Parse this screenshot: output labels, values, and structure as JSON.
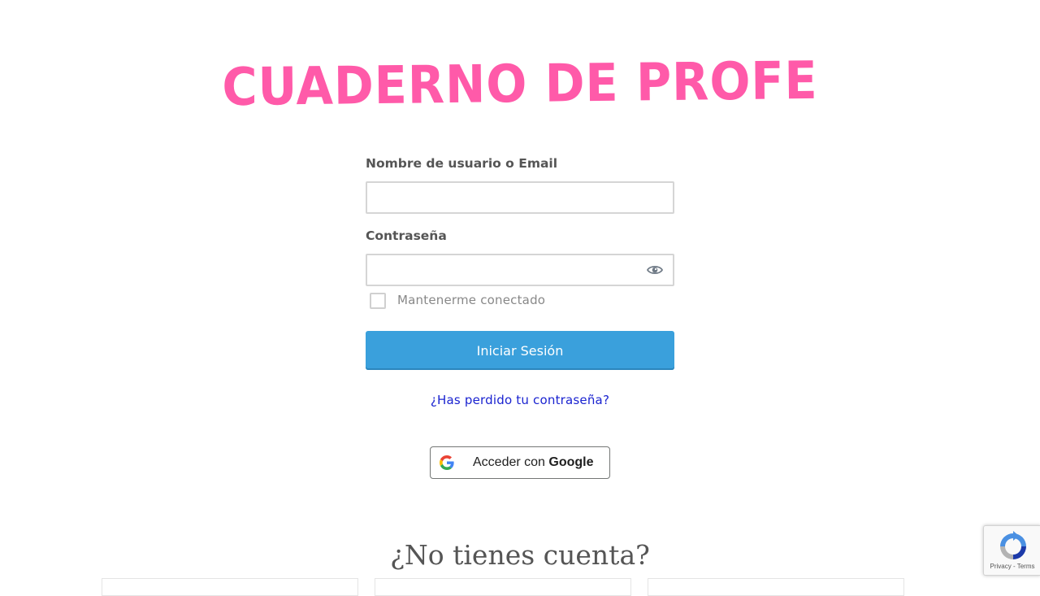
{
  "brand": {
    "title": "CUADERNO DE PROFE",
    "color": "#ff5aa9"
  },
  "login_form": {
    "username_label": "Nombre de usuario o Email",
    "username_value": "",
    "password_label": "Contraseña",
    "password_value": "",
    "password_toggle_icon": "eye-icon",
    "remember_label": "Mantenerme conectado",
    "remember_checked": false,
    "submit_label": "Iniciar Sesión",
    "submit_color": "#3aa0dc",
    "lost_password_link": "¿Has perdido tu contraseña?"
  },
  "google_login": {
    "prefix": "Acceder con",
    "brand": "Google",
    "icon": "google-g-icon"
  },
  "signup": {
    "heading": "¿No tienes cuenta?"
  },
  "recaptcha": {
    "links": "Privacy - Terms",
    "icon": "recaptcha-icon"
  }
}
